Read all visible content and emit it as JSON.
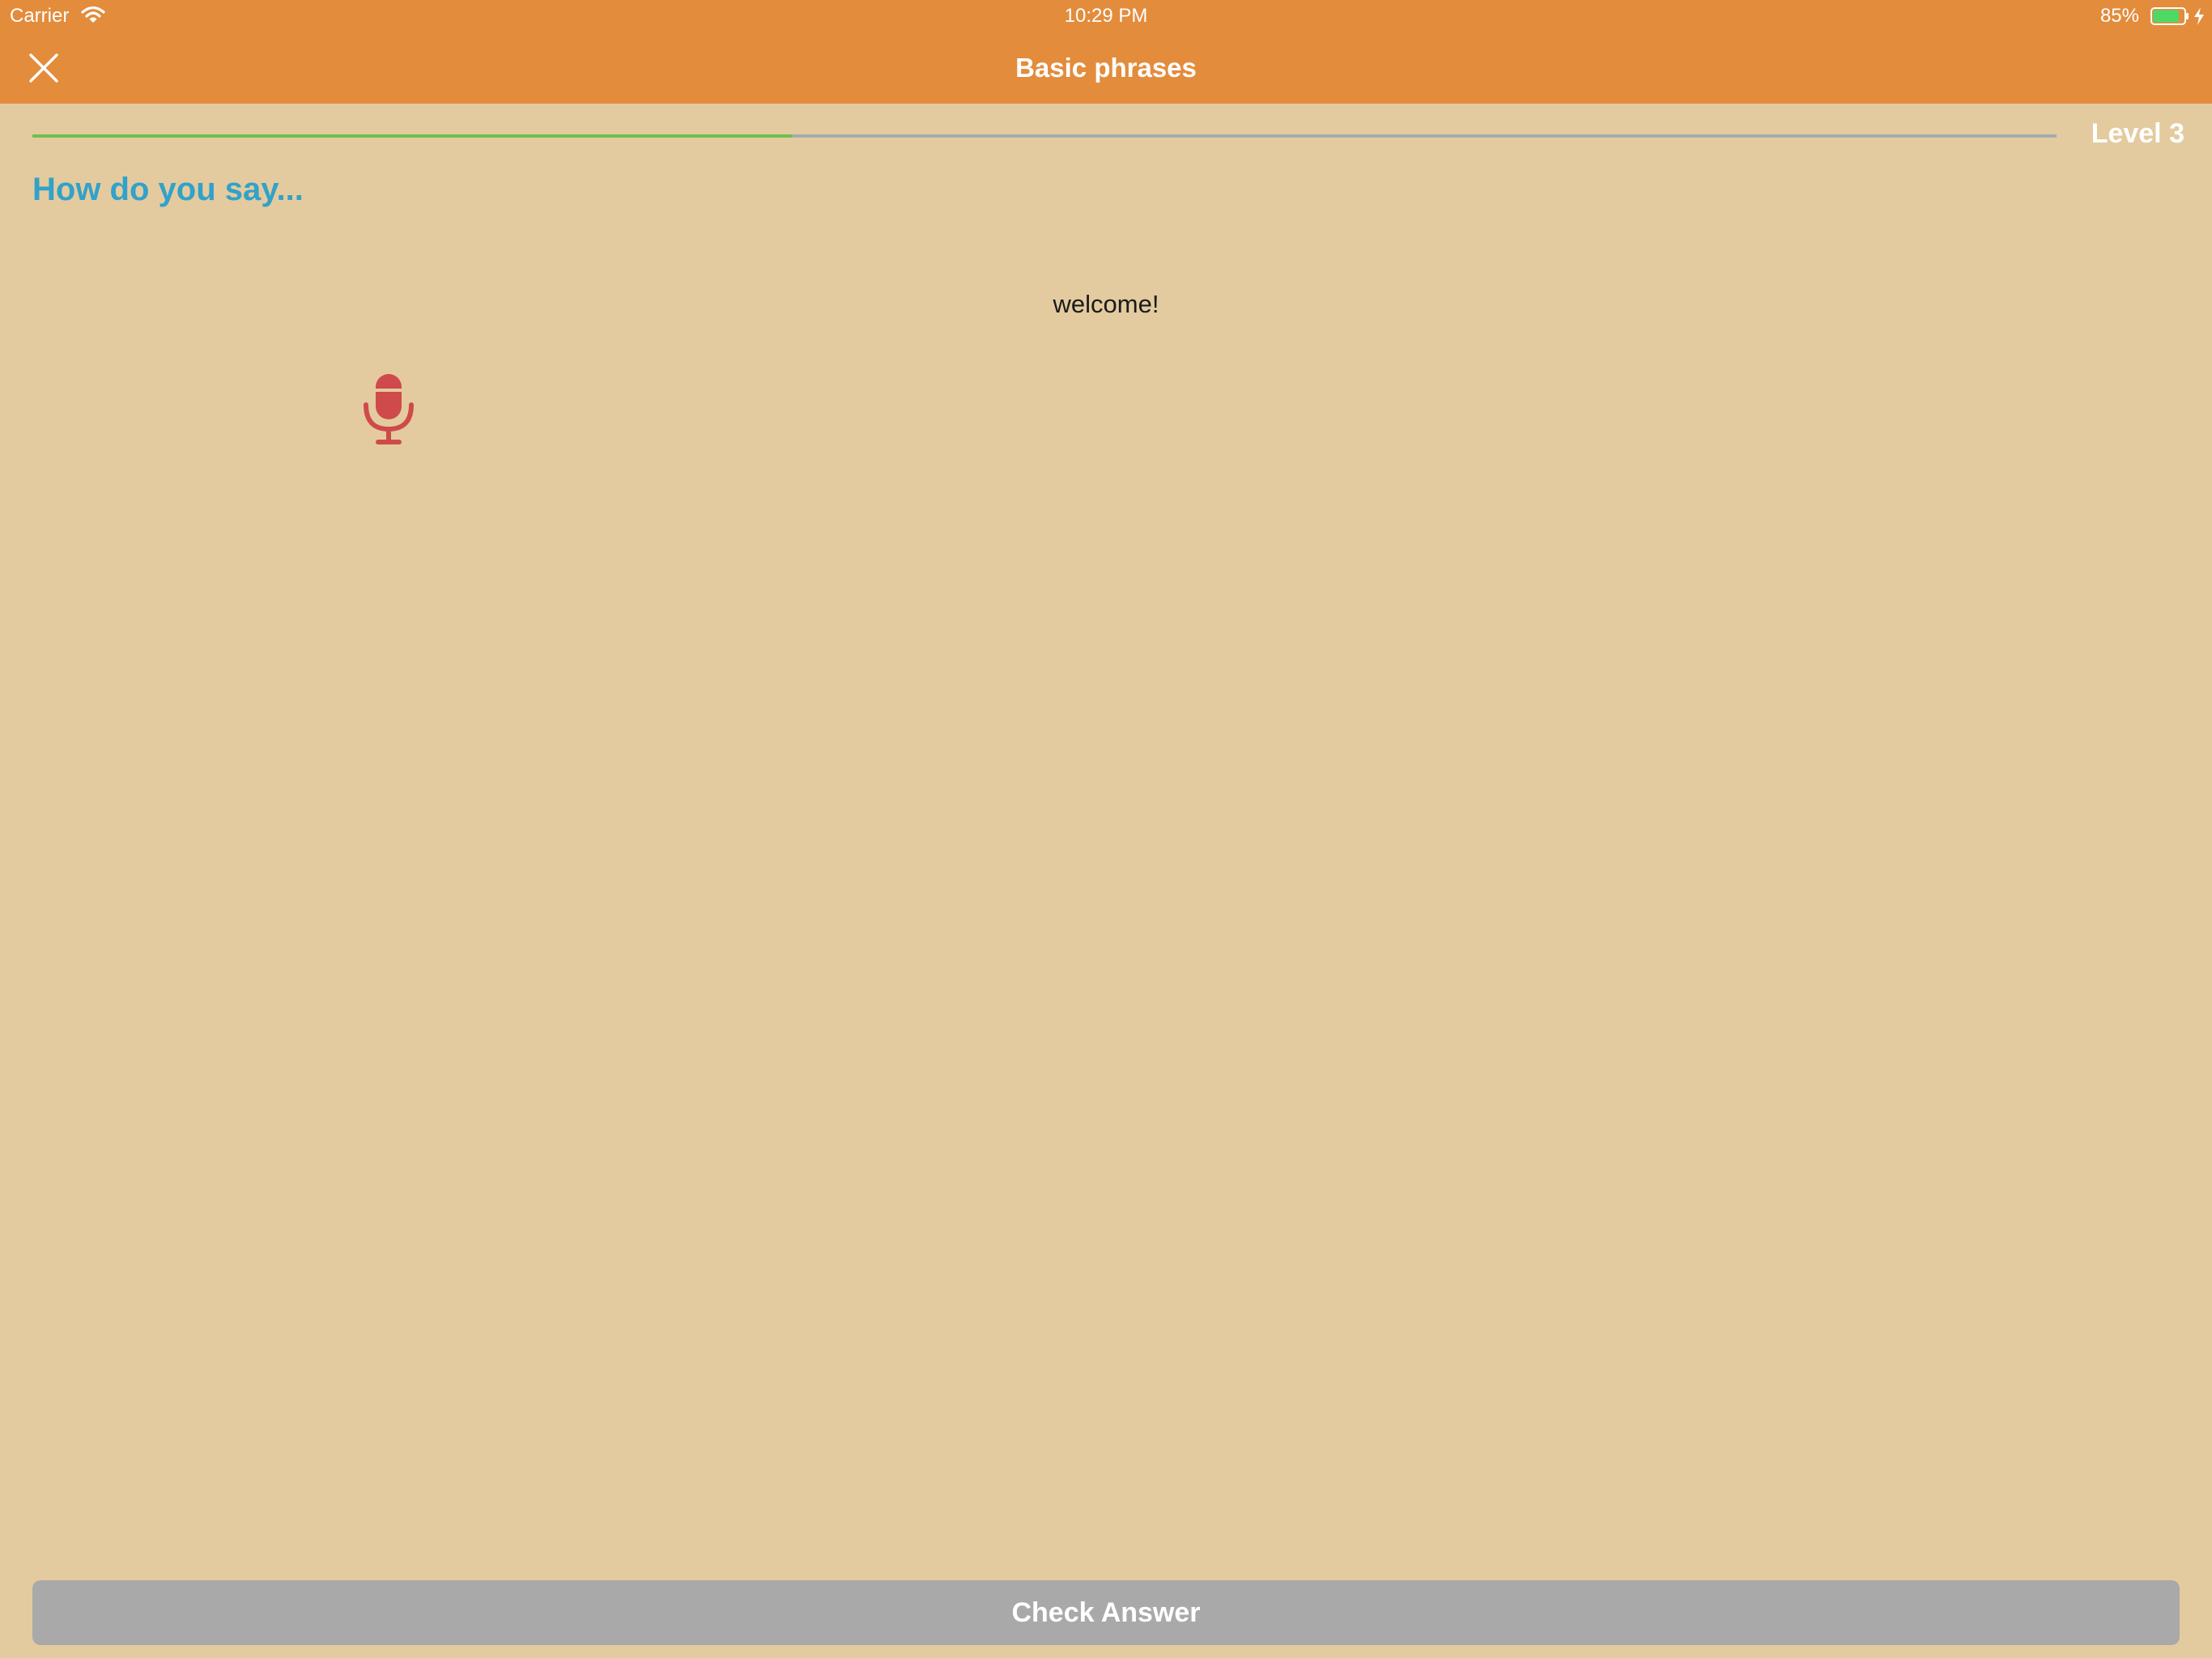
{
  "status_bar": {
    "carrier": "Carrier",
    "time": "10:29 PM",
    "battery_percent": "85%",
    "battery_level": 0.85,
    "icons": [
      "wifi-icon",
      "battery-icon",
      "charging-bolt-icon"
    ]
  },
  "nav": {
    "title": "Basic phrases",
    "close_icon": "close-icon"
  },
  "progress": {
    "fraction": 0.375,
    "level_label": "Level 3"
  },
  "prompt": {
    "heading": "How do you say...",
    "phrase": "welcome!",
    "mic_icon": "microphone-icon"
  },
  "actions": {
    "check_label": "Check Answer"
  },
  "colors": {
    "header": "#e38c3c",
    "background": "#e3cb9f",
    "progress_fill": "#6fbf53",
    "progress_track": "#a5acaf",
    "heading": "#33a1c9",
    "mic": "#cf4a4a",
    "button_disabled": "#a9a9a9"
  }
}
